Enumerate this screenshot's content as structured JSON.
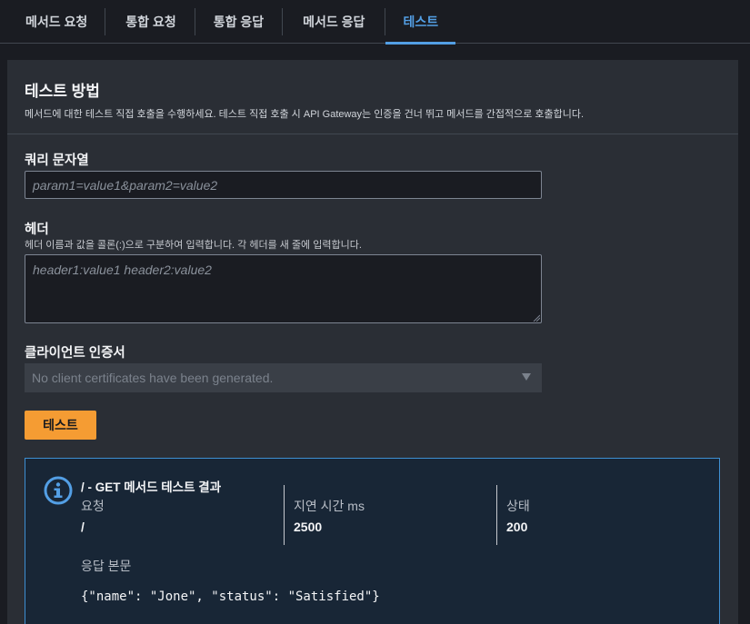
{
  "tabs": [
    {
      "label": "메서드 요청"
    },
    {
      "label": "통합 요청"
    },
    {
      "label": "통합 응답"
    },
    {
      "label": "메서드 응답"
    },
    {
      "label": "테스트",
      "active": true
    }
  ],
  "panel": {
    "title": "테스트 방법",
    "description": "메서드에 대한 테스트 직접 호출을 수행하세요. 테스트 직접 호출 시 API Gateway는 인증을 건너 뛰고 메서드를 간접적으로 호출합니다."
  },
  "query": {
    "label": "쿼리 문자열",
    "placeholder": "param1=value1&param2=value2"
  },
  "headers": {
    "label": "헤더",
    "help": "헤더 이름과 값을 콜론(:)으로 구분하여 입력합니다. 각 헤더를 새 줄에 입력합니다.",
    "placeholder": "header1:value1 header2:value2"
  },
  "client_cert": {
    "label": "클라이언트 인증서",
    "placeholder": "No client certificates have been generated."
  },
  "test_button": "테스트",
  "result": {
    "title": "/ - GET 메서드 테스트 결과",
    "request_label": "요청",
    "request_value": "/",
    "latency_label": "지연 시간 ms",
    "latency_value": "2500",
    "status_label": "상태",
    "status_value": "200",
    "body_label": "응답 본문",
    "body_value": "{\"name\": \"Jone\", \"status\": \"Satisfied\"}"
  },
  "colors": {
    "accent": "#539fe5",
    "button": "#f59c33",
    "info_border": "#3e8fd2"
  },
  "icons": {
    "info": "info-icon",
    "caret": "caret-down-icon"
  }
}
